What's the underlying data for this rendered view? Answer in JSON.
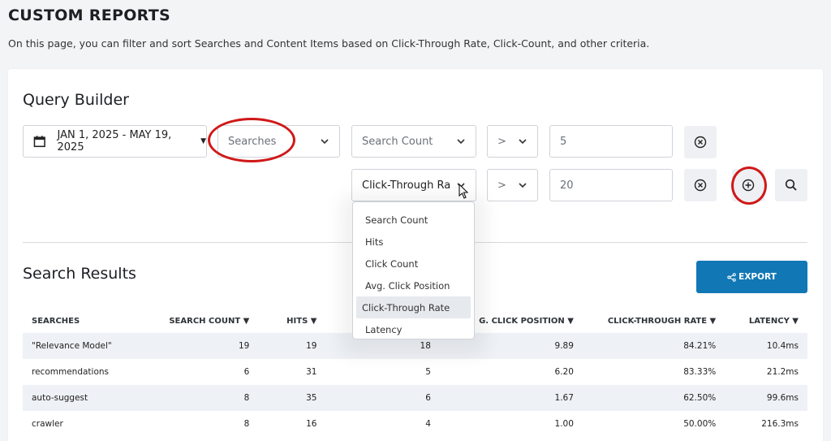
{
  "page": {
    "title": "CUSTOM REPORTS",
    "description": "On this page, you can filter and sort Searches and Content Items based on Click-Through Rate, Click-Count, and other criteria."
  },
  "query_builder": {
    "title": "Query Builder",
    "date_range": "JAN 1, 2025 - MAY 19, 2025",
    "source_select": "Searches",
    "rows": [
      {
        "metric": "Search Count",
        "operator": ">",
        "value": "5"
      },
      {
        "metric": "Click-Through Ra",
        "operator": ">",
        "value": "20"
      }
    ],
    "metric_options": [
      "Search Count",
      "Hits",
      "Click Count",
      "Avg. Click Position",
      "Click-Through Rate",
      "Latency"
    ],
    "selected_option": "Click-Through Rate"
  },
  "results": {
    "title": "Search Results",
    "export_label": "EXPORT",
    "columns": [
      "SEARCHES",
      "SEARCH COUNT ▼",
      "HITS ▼",
      "",
      "G. CLICK POSITION ▼",
      "CLICK-THROUGH RATE ▼",
      "LATENCY ▼"
    ],
    "rows": [
      [
        "\"Relevance Model\"",
        "19",
        "19",
        "18",
        "9.89",
        "84.21%",
        "10.4ms"
      ],
      [
        "recommendations",
        "6",
        "31",
        "5",
        "6.20",
        "83.33%",
        "21.2ms"
      ],
      [
        "auto-suggest",
        "8",
        "35",
        "6",
        "1.67",
        "62.50%",
        "99.6ms"
      ],
      [
        "crawler",
        "8",
        "16",
        "4",
        "1.00",
        "50.00%",
        "216.3ms"
      ]
    ]
  },
  "colors": {
    "accent": "#1178b5",
    "highlight_ring": "#d01818"
  },
  "icons": [
    "calendar-icon",
    "chevron-down-icon",
    "clear-icon",
    "add-circle-icon",
    "search-icon",
    "share-icon",
    "mouse-cursor-icon"
  ]
}
